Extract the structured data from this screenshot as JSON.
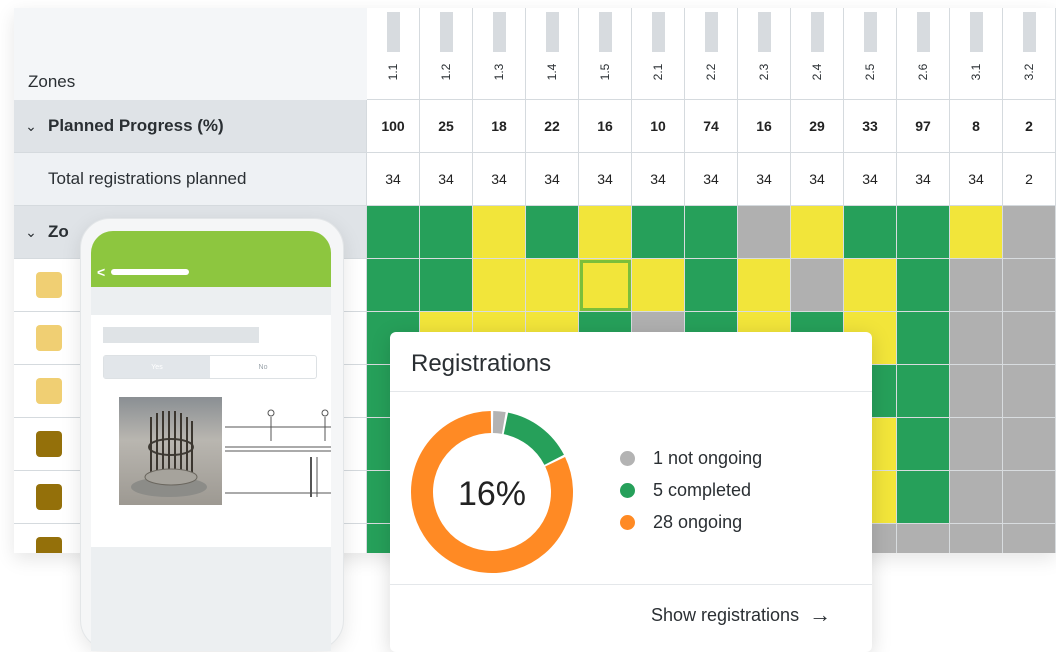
{
  "table": {
    "zones_header": "Zones",
    "columns": [
      "1.1",
      "1.2",
      "1.3",
      "1.4",
      "1.5",
      "2.1",
      "2.2",
      "2.3",
      "2.4",
      "2.5",
      "2.6",
      "3.1",
      "3.2"
    ],
    "rows": {
      "planned_progress": {
        "label": "Planned Progress (%)",
        "values": [
          "100",
          "25",
          "18",
          "22",
          "16",
          "10",
          "74",
          "16",
          "29",
          "33",
          "97",
          "8",
          "2"
        ]
      },
      "total_registrations": {
        "label": "Total registrations planned",
        "values": [
          "34",
          "34",
          "34",
          "34",
          "34",
          "34",
          "34",
          "34",
          "34",
          "34",
          "34",
          "34",
          "2"
        ]
      },
      "zone_group": {
        "label": "Zo"
      }
    },
    "status_grid": [
      [
        "g",
        "g",
        "y",
        "g",
        "y",
        "g",
        "g",
        "x",
        "y",
        "g",
        "g",
        "y",
        "x"
      ],
      [
        "g",
        "g",
        "y",
        "y",
        "y",
        "y",
        "g",
        "y",
        "x",
        "y",
        "g",
        "x",
        "x"
      ],
      [
        "g",
        "y",
        "y",
        "y",
        "g",
        "x",
        "g",
        "y",
        "g",
        "y",
        "g",
        "x",
        "x"
      ],
      [
        "g",
        "g",
        "g",
        "g",
        "g",
        "g",
        "g",
        "g",
        "g",
        "g",
        "g",
        "x",
        "x"
      ],
      [
        "g",
        "g",
        "g",
        "g",
        "g",
        "g",
        "g",
        "g",
        "g",
        "y",
        "g",
        "x",
        "x"
      ],
      [
        "g",
        "g",
        "g",
        "g",
        "g",
        "g",
        "g",
        "g",
        "g",
        "y",
        "g",
        "x",
        "x"
      ],
      [
        "g",
        "g",
        "g",
        "g",
        "g",
        "g",
        "g",
        "g",
        "g",
        "x",
        "x",
        "x",
        "x"
      ]
    ],
    "zone_swatch_colors": [
      "#f0cf73",
      "#f0cf73",
      "#f0cf73",
      "#94700a",
      "#94700a",
      "#94700a"
    ],
    "status_colors": {
      "completed": "#26a05a",
      "ongoing": "#f2e53a",
      "not_ongoing": "#b0b0b0"
    }
  },
  "phone": {
    "toggle_yes": "Yes",
    "toggle_no": "No",
    "header_color": "#8dc63f",
    "back_icon": "chevron-left-icon"
  },
  "registrations": {
    "title": "Registrations",
    "percent": "16%",
    "legend": [
      {
        "text": "1 not ongoing",
        "count": 1,
        "color": "#b3b3b3"
      },
      {
        "text": "5 completed",
        "count": 5,
        "color": "#26a05a"
      },
      {
        "text": "28 ongoing",
        "count": 28,
        "color": "#ff8a24"
      }
    ],
    "show_button": "Show registrations"
  }
}
